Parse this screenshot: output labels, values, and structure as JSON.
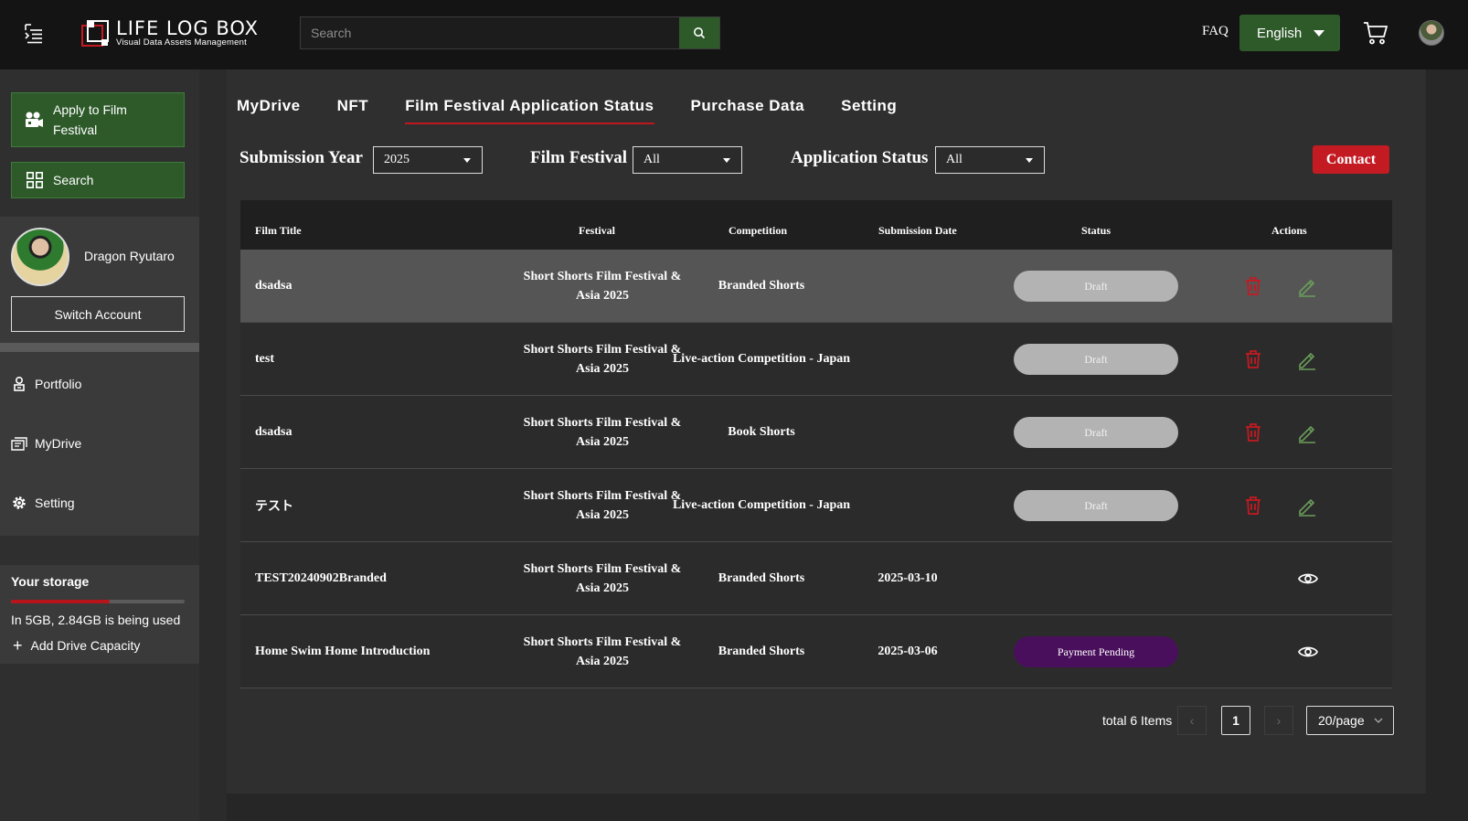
{
  "header": {
    "logo_title": "LIFE LOG BOX",
    "logo_subtitle": "Visual Data Assets Management",
    "search_placeholder": "Search",
    "faq": "FAQ",
    "language": "English"
  },
  "sidebar": {
    "apply_label": "Apply to Film Festival",
    "search_label": "Search",
    "user_name": "Dragon Ryutaro",
    "switch_account": "Switch Account",
    "nav": [
      {
        "label": "Portfolio",
        "icon": "portfolio-icon"
      },
      {
        "label": "MyDrive",
        "icon": "mydrive-icon"
      },
      {
        "label": "Setting",
        "icon": "gear-icon"
      }
    ],
    "storage": {
      "title": "Your storage",
      "used_fraction": 0.568,
      "text": "In 5GB, 2.84GB is being used",
      "add_capacity": "Add Drive Capacity"
    }
  },
  "tabs": [
    {
      "label": "MyDrive",
      "active": false
    },
    {
      "label": "NFT",
      "active": false
    },
    {
      "label": "Film Festival Application Status",
      "active": true
    },
    {
      "label": "Purchase Data",
      "active": false
    },
    {
      "label": "Setting",
      "active": false
    }
  ],
  "filters": {
    "year_label": "Submission Year",
    "year_value": "2025",
    "festival_label": "Film Festival",
    "festival_value": "All",
    "status_label": "Application Status",
    "status_value": "All",
    "contact": "Contact"
  },
  "table": {
    "headers": {
      "title": "Film Title",
      "festival": "Festival",
      "competition": "Competition",
      "date": "Submission Date",
      "status": "Status",
      "actions": "Actions"
    },
    "rows": [
      {
        "title": "dsadsa",
        "festival": "Short Shorts Film Festival & Asia 2025",
        "competition": "Branded Shorts",
        "date": "",
        "status": "Draft",
        "status_type": "draft",
        "actions": [
          "delete",
          "edit"
        ]
      },
      {
        "title": "test",
        "festival": "Short Shorts Film Festival & Asia 2025",
        "competition": "Live-action Competition - Japan",
        "date": "",
        "status": "Draft",
        "status_type": "draft",
        "actions": [
          "delete",
          "edit"
        ]
      },
      {
        "title": "dsadsa",
        "festival": "Short Shorts Film Festival & Asia 2025",
        "competition": "Book Shorts",
        "date": "",
        "status": "Draft",
        "status_type": "draft",
        "actions": [
          "delete",
          "edit"
        ]
      },
      {
        "title": "テスト",
        "festival": "Short Shorts Film Festival & Asia 2025",
        "competition": "Live-action Competition - Japan",
        "date": "",
        "status": "Draft",
        "status_type": "draft",
        "actions": [
          "delete",
          "edit"
        ]
      },
      {
        "title": "TEST20240902Branded",
        "festival": "Short Shorts Film Festival & Asia 2025",
        "competition": "Branded Shorts",
        "date": "2025-03-10",
        "status": "",
        "status_type": "none",
        "actions": [
          "view"
        ]
      },
      {
        "title": "Home Swim Home Introduction",
        "festival": "Short Shorts Film Festival & Asia 2025",
        "competition": "Branded Shorts",
        "date": "2025-03-06",
        "status": "Payment Pending",
        "status_type": "pending",
        "actions": [
          "view"
        ]
      }
    ]
  },
  "pagination": {
    "total": "total 6 Items",
    "current_page": "1",
    "per_page": "20/page"
  },
  "colors": {
    "accent_green": "#2e5a2a",
    "accent_red": "#c41a22",
    "pending_purple": "#4a0f5c",
    "draft_gray": "#b3b3b3"
  }
}
